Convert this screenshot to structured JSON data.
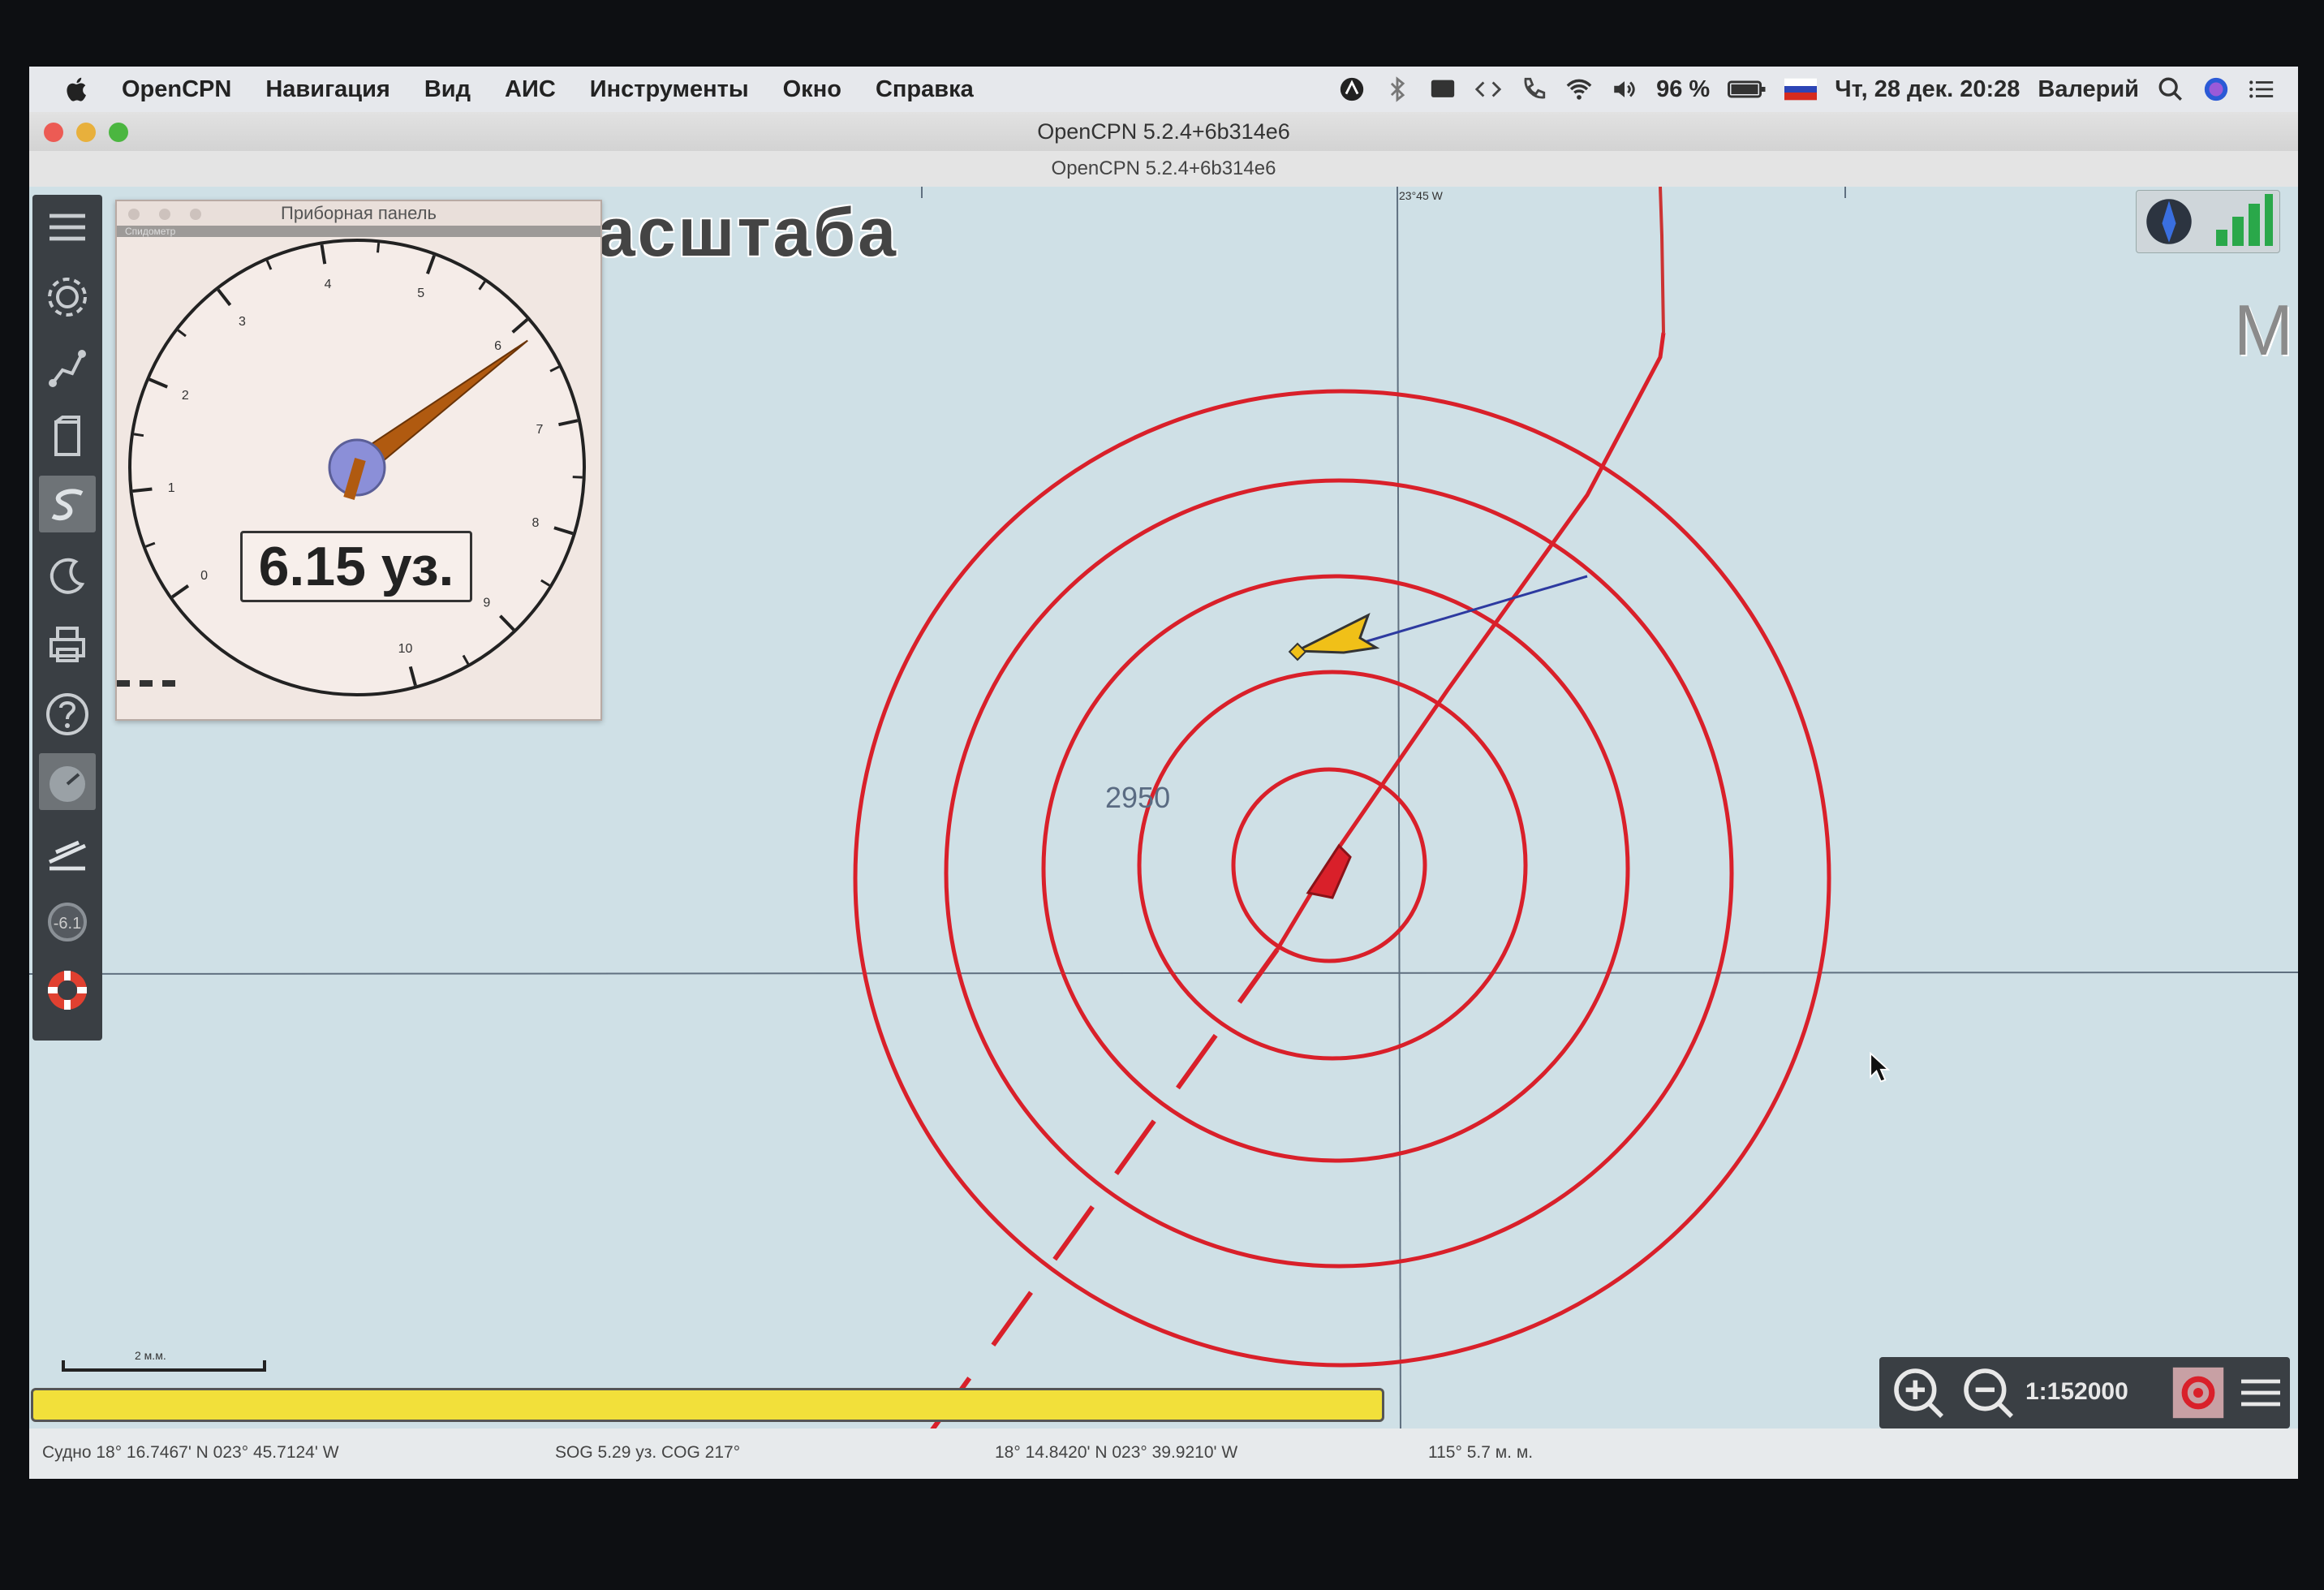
{
  "menubar": {
    "app": "OpenCPN",
    "items": [
      "Навигация",
      "Вид",
      "АИС",
      "Инструменты",
      "Окно",
      "Справка"
    ],
    "battery": "96 %",
    "datetime": "Чт, 28 дек.  20:28",
    "user": "Валерий"
  },
  "window": {
    "title": "OpenCPN 5.2.4+6b314e6",
    "subtitle": "OpenCPN 5.2.4+6b314e6"
  },
  "chart": {
    "scale_overlay": "асштаба",
    "right_overlay": "M",
    "depth_sounding": "2950",
    "longitude_label": "23°45 W",
    "scale_bar_label": "2 м.м."
  },
  "dashboard": {
    "title": "Приборная панель",
    "instrument": "Спидометр",
    "speed_text": "6.15 уз.",
    "speed_value": 6.15,
    "dial_max": 10,
    "dial_labels": [
      "0",
      "1",
      "2",
      "3",
      "4",
      "5",
      "6",
      "7",
      "8",
      "9",
      "10"
    ]
  },
  "zoom": {
    "level": "1:152000"
  },
  "status": {
    "ship": "Судно 18° 16.7467' N   023° 45.7124' W",
    "sog_cog": "SOG 5.29 уз.   COG 217°",
    "cursor": "18° 14.8420' N   023° 39.9210' W",
    "bearing": "115°  5.7 м. м."
  },
  "colors": {
    "range_rings": "#d9202a",
    "track": "#d9202a",
    "ais_target": "#f0c018",
    "accent_bar": "#f2e03a"
  }
}
